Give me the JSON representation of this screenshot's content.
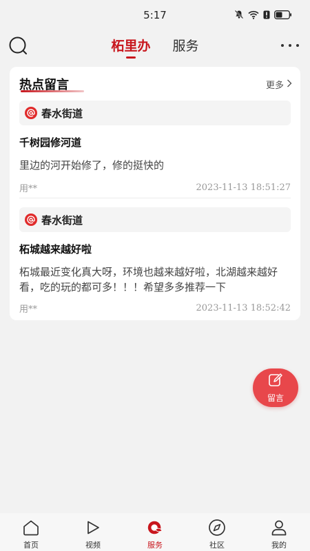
{
  "status_bar": {
    "time": "5:17"
  },
  "top_nav": {
    "tabs": [
      {
        "label": "柘里办",
        "active": true
      },
      {
        "label": "服务",
        "active": false
      }
    ]
  },
  "card": {
    "title": "热点留言",
    "more_label": "更多",
    "posts": [
      {
        "street": "春水街道",
        "title": "千树园修河道",
        "body": "里边的河开始修了，修的挺快的",
        "user": "用**",
        "time": "2023-11-13 18:51:27"
      },
      {
        "street": "春水街道",
        "title": "柘城越来越好啦",
        "body": "柘城最近变化真大呀，环境也越来越好啦，北湖越来越好看，吃的玩的都可多！！！希望多多推荐一下",
        "user": "用**",
        "time": "2023-11-13 18:52:42"
      }
    ]
  },
  "fab": {
    "label": "留言",
    "icon": "edit-icon"
  },
  "bottom_nav": {
    "items": [
      {
        "label": "首页",
        "icon": "home-icon",
        "active": false
      },
      {
        "label": "视频",
        "icon": "play-icon",
        "active": false
      },
      {
        "label": "服务",
        "icon": "service-icon",
        "active": true
      },
      {
        "label": "社区",
        "icon": "compass-icon",
        "active": false
      },
      {
        "label": "我的",
        "icon": "user-icon",
        "active": false
      }
    ]
  },
  "colors": {
    "accent": "#c8161d",
    "fab": "#e8474b",
    "background": "#f2f2f2"
  }
}
